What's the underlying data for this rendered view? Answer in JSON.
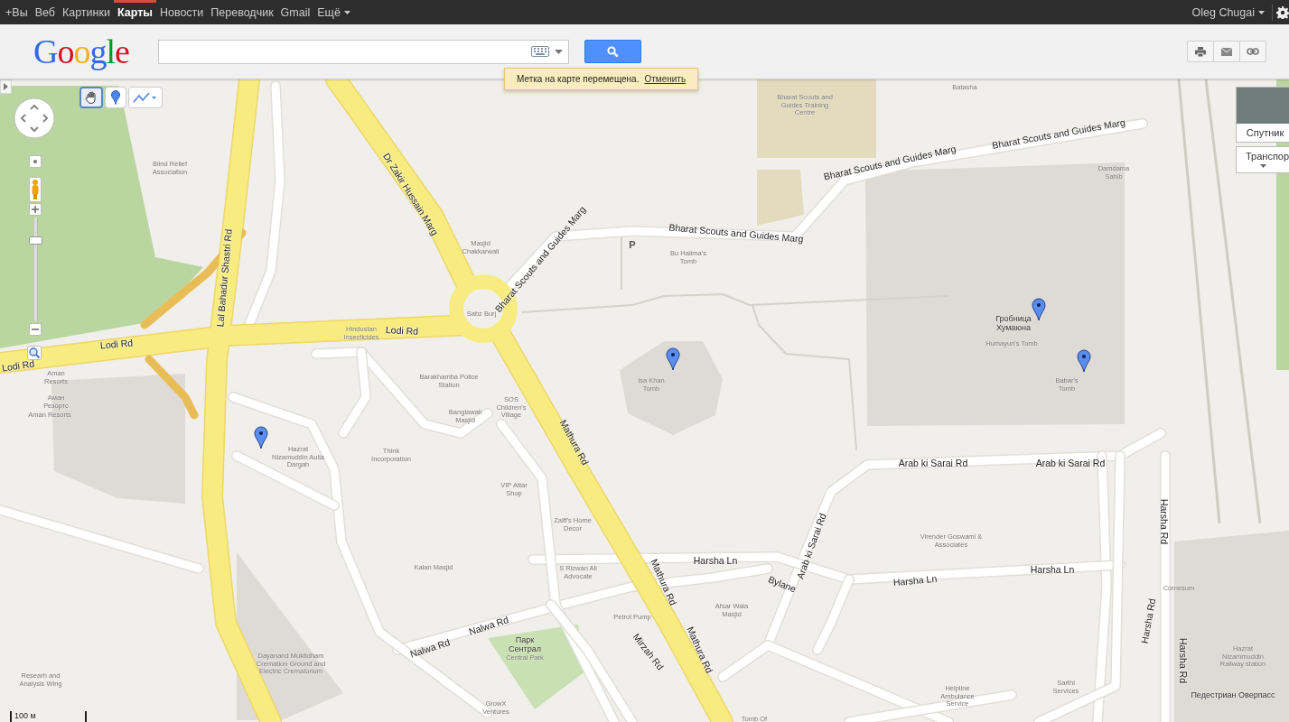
{
  "top_bar": {
    "links": [
      {
        "label": "+Вы",
        "selected": false
      },
      {
        "label": "Веб",
        "selected": false
      },
      {
        "label": "Картинки",
        "selected": false
      },
      {
        "label": "Карты",
        "selected": true
      },
      {
        "label": "Новости",
        "selected": false
      },
      {
        "label": "Переводчик",
        "selected": false
      },
      {
        "label": "Gmail",
        "selected": false
      }
    ],
    "more": "Ещё",
    "user": "Oleg Chugai"
  },
  "header": {
    "logo": "Google"
  },
  "notification": {
    "message": "Метка на карте перемещена.",
    "action": "Отменить"
  },
  "map_controls": {
    "tools": [
      {
        "kind": "hand",
        "selected": true
      },
      {
        "kind": "marker",
        "selected": false
      },
      {
        "kind": "line",
        "selected": false
      }
    ],
    "zoom": {
      "level": 0.8
    }
  },
  "map_types": [
    {
      "label": "Спутник",
      "kind": "satellite"
    },
    {
      "label": "Транспор",
      "kind": "menu"
    }
  ],
  "scale": "100 м",
  "map": {
    "labels": [
      {
        "text": "Lodi Rd",
        "kind": "road"
      },
      {
        "text": "Lodi Rd",
        "kind": "road"
      },
      {
        "text": "Lodi Rd",
        "kind": "road"
      },
      {
        "text": "Lal Bahadur Shastri Rd",
        "kind": "road"
      },
      {
        "text": "Dr Zakir Hussain Marg",
        "kind": "road"
      },
      {
        "text": "Bharat Scouts and Guides Marg",
        "kind": "road"
      },
      {
        "text": "Bharat Scouts and Guides Marg",
        "kind": "road"
      },
      {
        "text": "Bharat Scouts and Guides Marg",
        "kind": "road"
      },
      {
        "text": "Bharat Scouts and Guides Marg",
        "kind": "road"
      },
      {
        "text": "Mathura Rd",
        "kind": "road"
      },
      {
        "text": "Mathura Rd",
        "kind": "road"
      },
      {
        "text": "Mathura Rd",
        "kind": "road"
      },
      {
        "text": "Arab ki Sarai Rd",
        "kind": "road"
      },
      {
        "text": "Arab ki Sarai Rd",
        "kind": "road"
      },
      {
        "text": "Arab ki Sarai Rd",
        "kind": "road"
      },
      {
        "text": "Harsha Ln",
        "kind": "road"
      },
      {
        "text": "Harsha Ln",
        "kind": "road"
      },
      {
        "text": "Harsha Ln",
        "kind": "road"
      },
      {
        "text": "Harsha Rd",
        "kind": "road"
      },
      {
        "text": "Harsha Rd",
        "kind": "road"
      },
      {
        "text": "Harsha Rd",
        "kind": "road"
      },
      {
        "text": "Bylane",
        "kind": "road"
      },
      {
        "text": "Nalwa Rd",
        "kind": "road"
      },
      {
        "text": "Nalwa Rd",
        "kind": "road"
      },
      {
        "text": "Mirzah Rd",
        "kind": "road"
      },
      {
        "text": "Batasha",
        "kind": "place"
      },
      {
        "text": "Bharat Scouts and Guides Training Centre",
        "kind": "place"
      },
      {
        "text": "Damdama Sahib",
        "kind": "place"
      },
      {
        "text": "Blind Relief Association",
        "kind": "place"
      },
      {
        "text": "Masjid Chakkarwali",
        "kind": "place"
      },
      {
        "text": "P",
        "kind": "parking"
      },
      {
        "text": "Bu Halima's Tomb",
        "kind": "place"
      },
      {
        "text": "Sabz Burj",
        "kind": "place"
      },
      {
        "text": "Hindustan Insecticides",
        "kind": "place"
      },
      {
        "text": "Гробница Хумаюна",
        "kind": "landmark"
      },
      {
        "text": "Humayun's Tomb",
        "kind": "place"
      },
      {
        "text": "Babar's Tomb",
        "kind": "place"
      },
      {
        "text": "Isa Khan Tomb",
        "kind": "place"
      },
      {
        "text": "Aman Resorts",
        "kind": "place"
      },
      {
        "text": "Аман Резортс",
        "kind": "place"
      },
      {
        "text": "Aman Resorts",
        "kind": "place"
      },
      {
        "text": "Barakhamba Police Station",
        "kind": "place"
      },
      {
        "text": "SOS Children's Village",
        "kind": "place"
      },
      {
        "text": "Banglawali Masjid",
        "kind": "place"
      },
      {
        "text": "Hazrat Nizamuddin Aulia Dargah",
        "kind": "place"
      },
      {
        "text": "Think Incorporation",
        "kind": "place"
      },
      {
        "text": "VIP Attar Shop",
        "kind": "place"
      },
      {
        "text": "Zaiff's Home Decor",
        "kind": "place"
      },
      {
        "text": "Kalan Masjid",
        "kind": "place"
      },
      {
        "text": "S Rizwan Ali Advocate",
        "kind": "place"
      },
      {
        "text": "Petrol Pump",
        "kind": "place"
      },
      {
        "text": "Dayanand Muktidham Cremation Ground and Electric Crematorium",
        "kind": "place"
      },
      {
        "text": "Парк Сентрал",
        "kind": "landmark"
      },
      {
        "text": "Central Park",
        "kind": "place"
      },
      {
        "text": "Researh and Analysis Wing",
        "kind": "place"
      },
      {
        "text": "GrowX Ventures",
        "kind": "place"
      },
      {
        "text": "Afsar Wala Masjid",
        "kind": "place"
      },
      {
        "text": "Virender Goswami & Associates",
        "kind": "place"
      },
      {
        "text": "Helpline Ambulance Service",
        "kind": "place"
      },
      {
        "text": "Sarthi Services",
        "kind": "place"
      },
      {
        "text": "Cornesum",
        "kind": "place"
      },
      {
        "text": "Hazrat Nizammuddin Railway station",
        "kind": "place"
      },
      {
        "text": "Педестриан Оверпасс",
        "kind": "landmark"
      },
      {
        "text": "Tomb Of",
        "kind": "place"
      }
    ]
  }
}
